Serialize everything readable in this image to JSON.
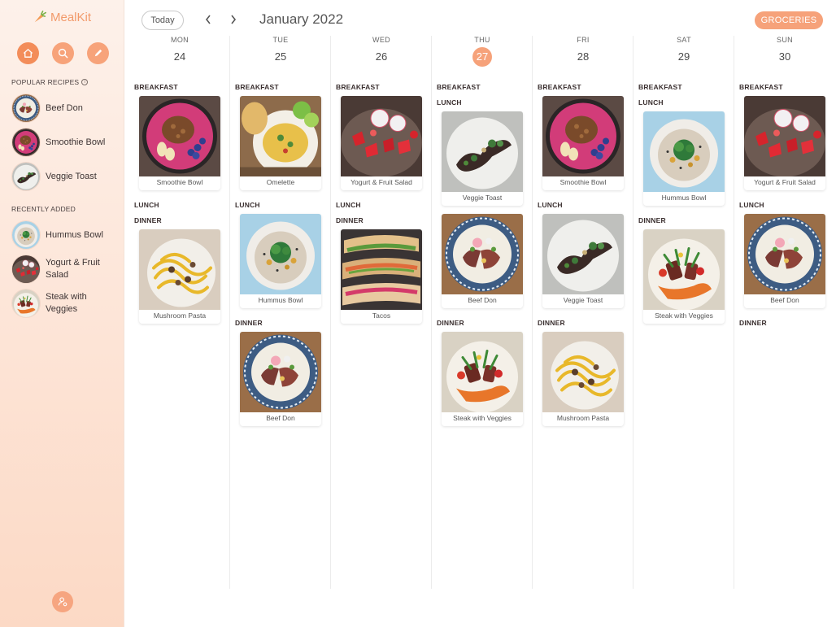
{
  "app": {
    "name": "MealKit"
  },
  "sidebar": {
    "popular_title": "POPULAR RECIPES",
    "popular": [
      {
        "label": "Beef Don",
        "img": "beef-don"
      },
      {
        "label": "Smoothie Bowl",
        "img": "smoothie-bowl"
      },
      {
        "label": "Veggie Toast",
        "img": "veggie-toast"
      }
    ],
    "recent_title": "RECENTLY ADDED",
    "recent": [
      {
        "label": "Hummus Bowl",
        "img": "hummus-bowl"
      },
      {
        "label": "Yogurt & Fruit Salad",
        "img": "yogurt-fruit-salad"
      },
      {
        "label": "Steak with Veggies",
        "img": "steak-veggies"
      }
    ]
  },
  "header": {
    "today_label": "Today",
    "month_title": "January 2022",
    "groceries_label": "GROCERIES"
  },
  "colors": {
    "accent": "#f6a27a",
    "sidebar_bg": "#fde4d6"
  },
  "meal_labels": {
    "breakfast": "BREAKFAST",
    "lunch": "LUNCH",
    "dinner": "DINNER"
  },
  "days": [
    {
      "dow": "MON",
      "date": "24",
      "today": false,
      "breakfast": [
        {
          "name": "Smoothie Bowl",
          "img": "smoothie-bowl"
        }
      ],
      "lunch": [],
      "dinner": [
        {
          "name": "Mushroom Pasta",
          "img": "mushroom-pasta"
        }
      ]
    },
    {
      "dow": "TUE",
      "date": "25",
      "today": false,
      "breakfast": [
        {
          "name": "Omelette",
          "img": "omelette"
        }
      ],
      "lunch": [
        {
          "name": "Hummus Bowl",
          "img": "hummus-bowl"
        }
      ],
      "dinner": [
        {
          "name": "Beef Don",
          "img": "beef-don"
        }
      ]
    },
    {
      "dow": "WED",
      "date": "26",
      "today": false,
      "breakfast": [
        {
          "name": "Yogurt & Fruit Salad",
          "img": "yogurt-fruit-salad"
        }
      ],
      "lunch": [],
      "dinner": [
        {
          "name": "Tacos",
          "img": "tacos"
        }
      ]
    },
    {
      "dow": "THU",
      "date": "27",
      "today": true,
      "breakfast": [],
      "lunch": [
        {
          "name": "Veggie Toast",
          "img": "veggie-toast"
        },
        {
          "name": "Beef Don",
          "img": "beef-don"
        }
      ],
      "dinner": [
        {
          "name": "Steak with Veggies",
          "img": "steak-veggies"
        }
      ]
    },
    {
      "dow": "FRI",
      "date": "28",
      "today": false,
      "breakfast": [
        {
          "name": "Smoothie Bowl",
          "img": "smoothie-bowl"
        }
      ],
      "lunch": [
        {
          "name": "Veggie Toast",
          "img": "veggie-toast"
        }
      ],
      "dinner": [
        {
          "name": "Mushroom Pasta",
          "img": "mushroom-pasta"
        }
      ]
    },
    {
      "dow": "SAT",
      "date": "29",
      "today": false,
      "breakfast": [],
      "lunch": [
        {
          "name": "Hummus Bowl",
          "img": "hummus-bowl"
        }
      ],
      "dinner": [
        {
          "name": "Steak with Veggies",
          "img": "steak-veggies"
        }
      ]
    },
    {
      "dow": "SUN",
      "date": "30",
      "today": false,
      "breakfast": [
        {
          "name": "Yogurt & Fruit Salad",
          "img": "yogurt-fruit-salad"
        }
      ],
      "lunch": [
        {
          "name": "Beef Don",
          "img": "beef-don"
        }
      ],
      "dinner": []
    }
  ]
}
